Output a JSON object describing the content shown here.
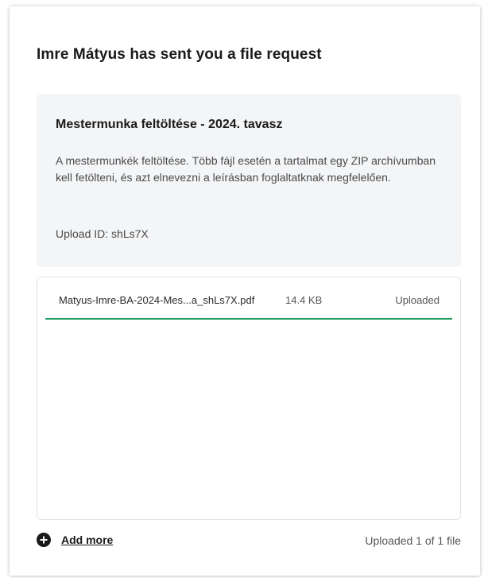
{
  "header": {
    "title": "Imre Mátyus has sent you a file request"
  },
  "request": {
    "title": "Mestermunka feltöltése - 2024. tavasz",
    "description": "A mestermunkék feltöltése. Több fájl esetén a tartalmat egy ZIP archívumban kell fetölteni, és azt elnevezni a leírásban foglaltatknak megfelelően.",
    "upload_id": "Upload ID: shLs7X"
  },
  "files": [
    {
      "name": "Matyus-Imre-BA-2024-Mes...a_shLs7X.pdf",
      "size": "14.4 KB",
      "status": "Uploaded",
      "progress": 1.0
    }
  ],
  "footer": {
    "add_more_label": "Add more",
    "add_more_icon": "plus-circle-icon",
    "upload_count": "Uploaded 1 of 1 file"
  },
  "colors": {
    "progress": "#1a9a5c",
    "request_box_bg": "#f4f5f7"
  }
}
